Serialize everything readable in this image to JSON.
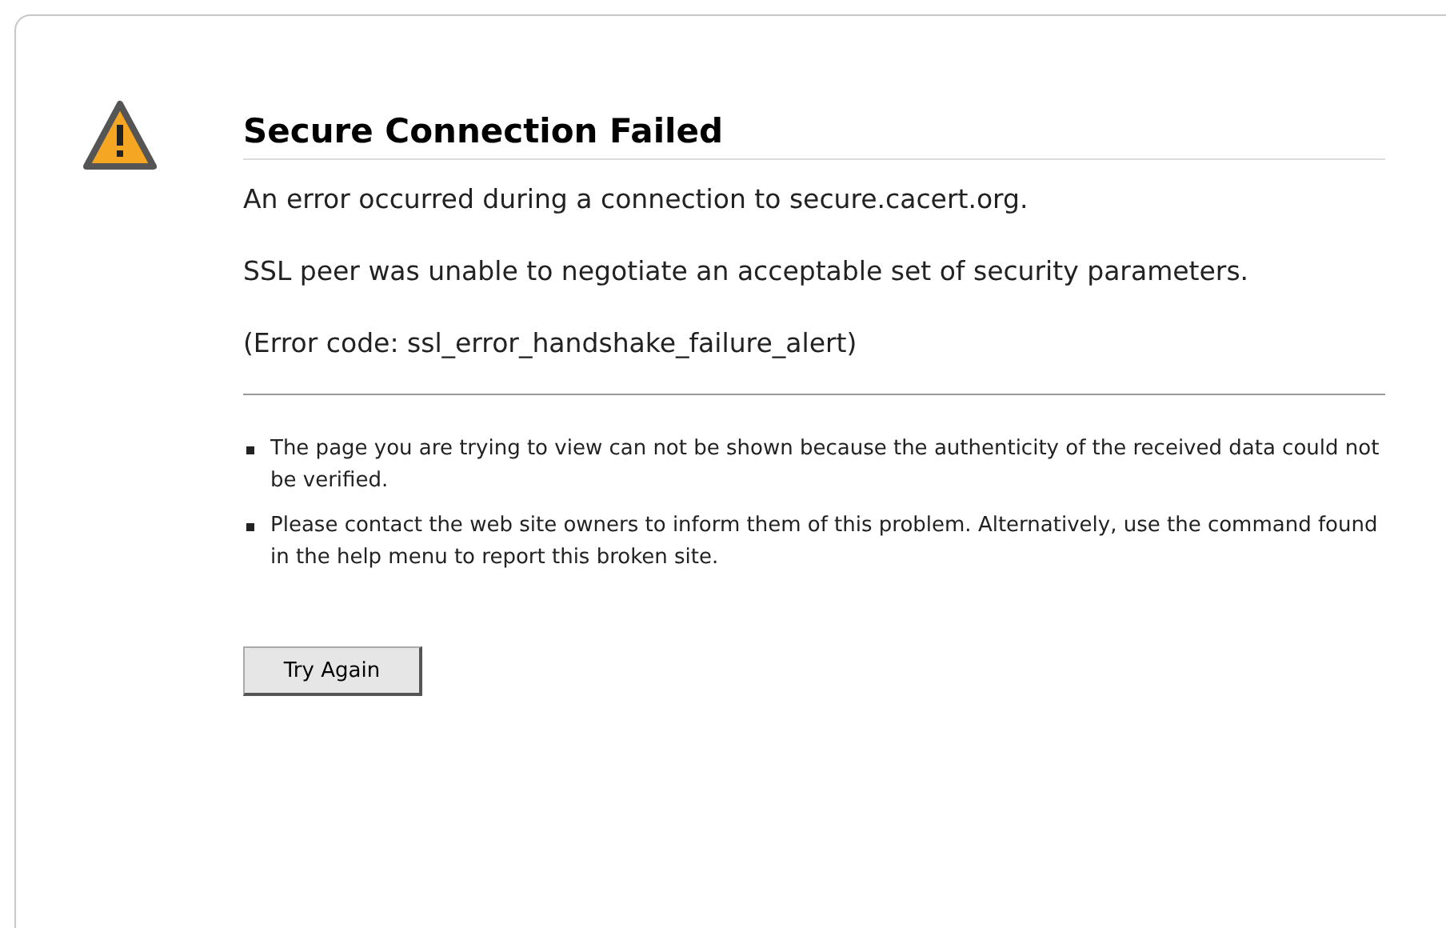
{
  "error_page": {
    "title": "Secure Connection Failed",
    "messages": [
      "An error occurred during a connection to secure.cacert.org.",
      "SSL peer was unable to negotiate an acceptable set of security parameters.",
      "(Error code: ssl_error_handshake_failure_alert)"
    ],
    "details": [
      "The page you are trying to view can not be shown because the authenticity of the received data could not be verified.",
      "Please contact the web site owners to inform them of this problem. Alternatively, use the command found in the help menu to report this broken site."
    ],
    "button": "Try Again"
  }
}
